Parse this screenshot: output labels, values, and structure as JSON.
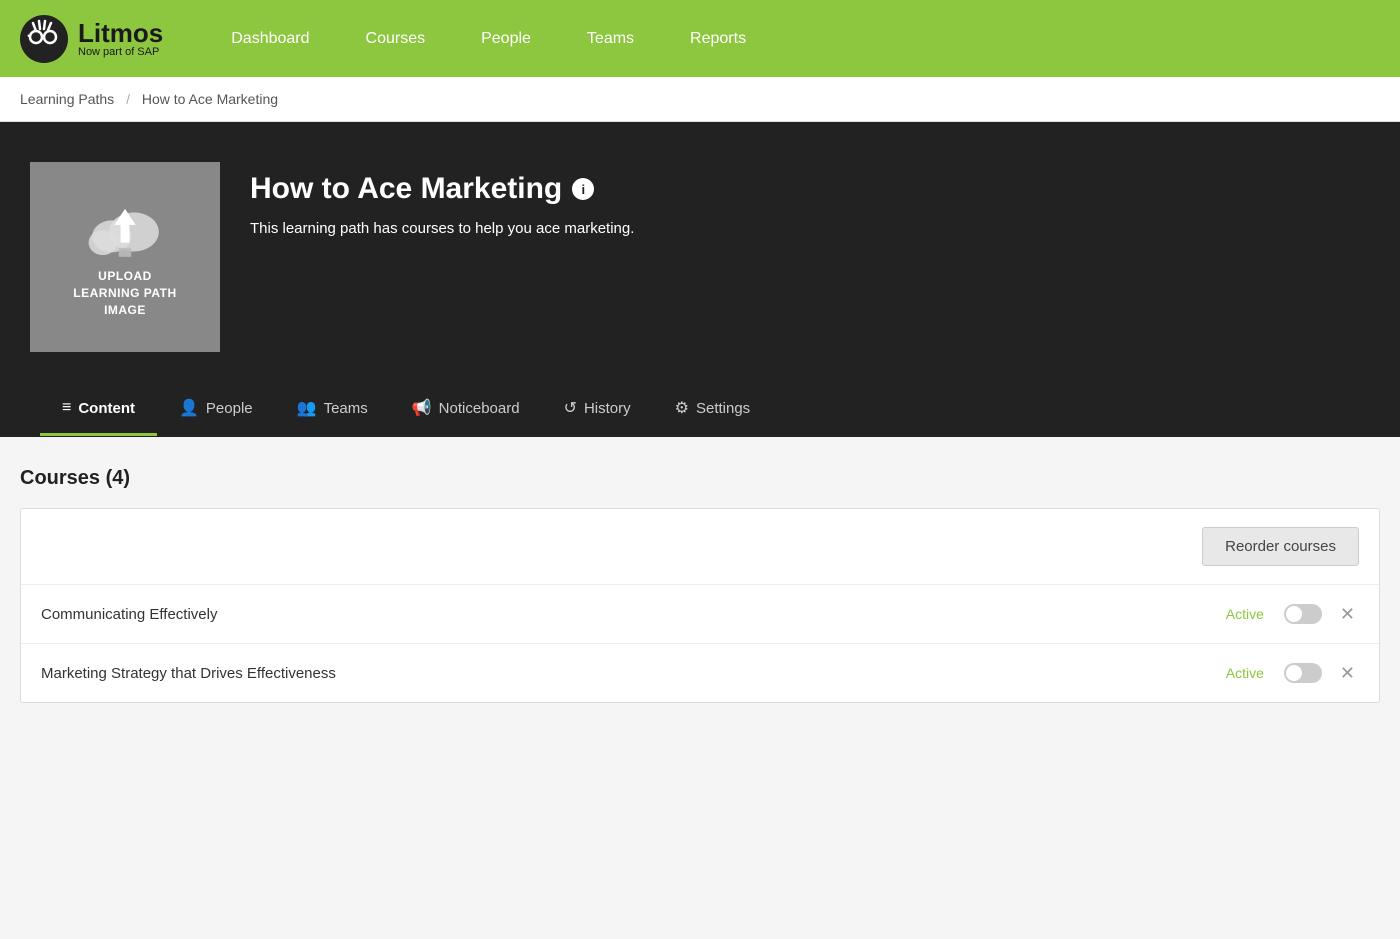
{
  "navbar": {
    "brand_title": "Litmos",
    "brand_sub": "Now part of SAP",
    "nav_items": [
      {
        "label": "Dashboard",
        "href": "#"
      },
      {
        "label": "Courses",
        "href": "#"
      },
      {
        "label": "People",
        "href": "#"
      },
      {
        "label": "Teams",
        "href": "#"
      },
      {
        "label": "Reports",
        "href": "#"
      }
    ]
  },
  "breadcrumb": {
    "parent": "Learning Paths",
    "separator": "/",
    "current": "How to Ace Marketing"
  },
  "hero": {
    "upload_label": "UPLOAD\nLEARNING PATH\nIMAGE",
    "title": "How to Ace Marketing",
    "info_icon": "i",
    "description": "This learning path has courses to help you ace marketing."
  },
  "tabs": [
    {
      "id": "content",
      "label": "Content",
      "icon": "≡",
      "active": true
    },
    {
      "id": "people",
      "label": "People",
      "icon": "👤",
      "active": false
    },
    {
      "id": "teams",
      "label": "Teams",
      "icon": "👥",
      "active": false
    },
    {
      "id": "noticeboard",
      "label": "Noticeboard",
      "icon": "📢",
      "active": false
    },
    {
      "id": "history",
      "label": "History",
      "icon": "↺",
      "active": false
    },
    {
      "id": "settings",
      "label": "Settings",
      "icon": "⚙",
      "active": false
    }
  ],
  "section_title": "Courses (4)",
  "reorder_button": "Reorder courses",
  "courses": [
    {
      "name": "Communicating Effectively",
      "status": "Active"
    },
    {
      "name": "Marketing Strategy that Drives Effectiveness",
      "status": "Active"
    }
  ]
}
